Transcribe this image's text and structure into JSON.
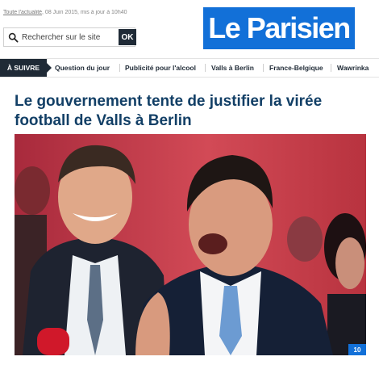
{
  "topbar": {
    "link": "Toute l'actualité",
    "meta": ", 08 Juin 2015, mis à jour à 10h40"
  },
  "search": {
    "placeholder": "Rechercher sur le site",
    "button_label": "OK"
  },
  "logo": {
    "text": "Le Parisien"
  },
  "nav": {
    "highlight": "À SUIVRE",
    "items": [
      "Question du jour",
      "Publicité pour l'alcool",
      "Valls à Berlin",
      "France-Belgique",
      "Wawrinka"
    ]
  },
  "article": {
    "headline": "Le gouvernement tente de justifier la virée football de Valls à Berlin",
    "photo_count": "10"
  },
  "colors": {
    "brand_blue": "#1270d8",
    "nav_dark": "#1f2a36",
    "headline": "#123f66",
    "photo_background": "#c1374a"
  },
  "icons": [
    "search-icon"
  ]
}
